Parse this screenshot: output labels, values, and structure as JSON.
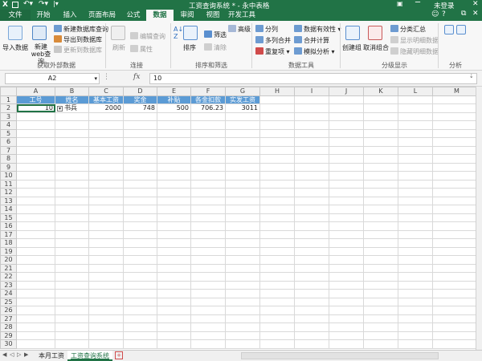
{
  "window": {
    "title": "工资查询系统 * - 永中表格",
    "login": "未登录"
  },
  "tabs": [
    "文件",
    "开始",
    "插入",
    "页面布局",
    "公式",
    "数据",
    "审阅",
    "视图",
    "开发工具"
  ],
  "active_tab": "数据",
  "ribbon": {
    "groups": {
      "external": "获取外部数据",
      "connect": "连接",
      "sort": "排序和筛选",
      "tools": "数据工具",
      "outline": "分级显示",
      "analysis": "分析"
    },
    "buttons": {
      "import": "导入数据",
      "web": "新建 web查询",
      "newdb": "新建数据库查询",
      "exportdb": "导出到数据库",
      "updatedb": "更新到数据库",
      "refresh": "刷新",
      "editquery": "编辑查询",
      "props": "属性",
      "sort": "排序",
      "filter": "筛选",
      "clear": "清除",
      "advanced": "高级",
      "split": "分列",
      "multisplit": "多列合并",
      "dup": "重复项",
      "validity": "数据有效性",
      "consolidate": "合并计算",
      "whatif": "模拟分析",
      "group": "创建组",
      "ungroup": "取消组合",
      "subtotal": "分类汇总",
      "showdetail": "显示明细数据",
      "hidedetail": "隐藏明细数据"
    }
  },
  "formula_bar": {
    "name_box": "A2",
    "fx": "fx",
    "value": "10"
  },
  "sheet": {
    "columns": [
      "A",
      "B",
      "C",
      "D",
      "E",
      "F",
      "G",
      "H",
      "I",
      "J",
      "K",
      "L",
      "M"
    ],
    "rows": [
      "1",
      "2",
      "3",
      "4",
      "5",
      "6",
      "7",
      "8",
      "9",
      "10",
      "11",
      "12",
      "13",
      "14",
      "15",
      "16",
      "17",
      "18",
      "19",
      "20",
      "21",
      "22",
      "23",
      "24",
      "25",
      "26",
      "27",
      "28",
      "29",
      "30"
    ],
    "headers": [
      "工号",
      "姓名",
      "基本工资",
      "奖金",
      "补贴",
      "各金扣款",
      "实发工资"
    ],
    "data_row": [
      "10",
      "书兵",
      "2000",
      "748",
      "500",
      "706.23",
      "3011"
    ]
  },
  "sheet_tabs": [
    "本月工资",
    "工资查询系统"
  ],
  "active_sheet": "工资查询系统"
}
